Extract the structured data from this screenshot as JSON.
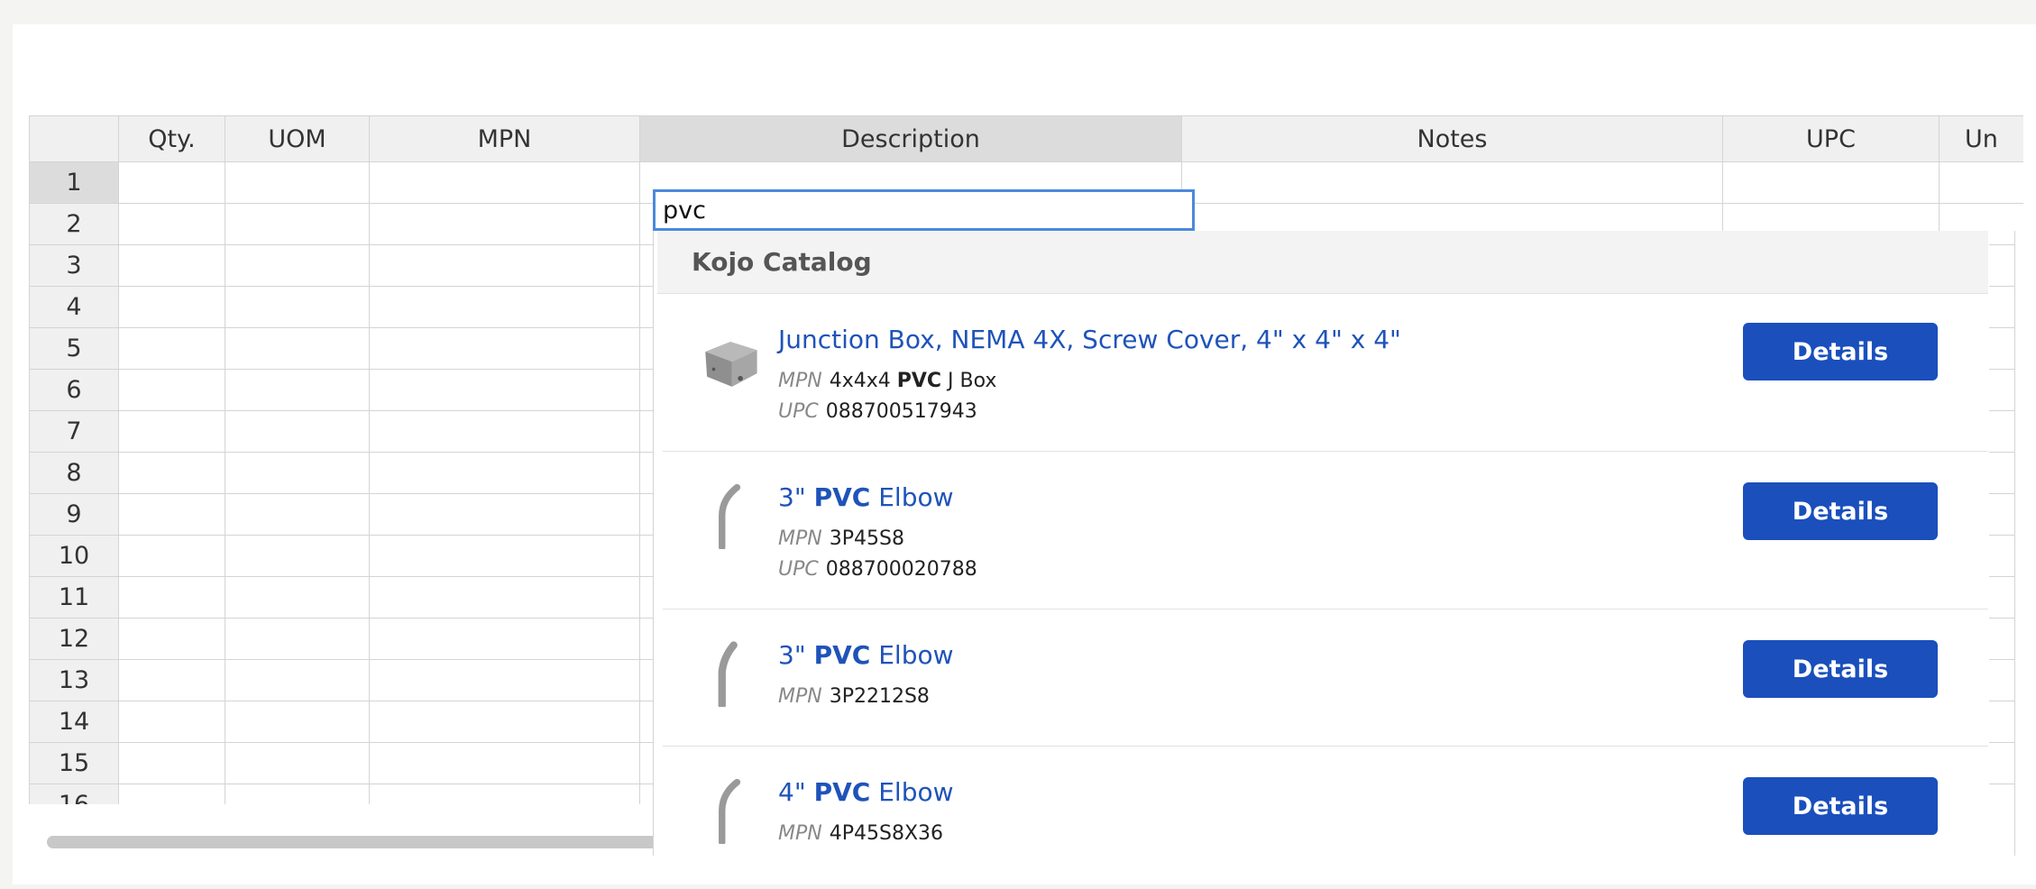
{
  "grid": {
    "headers": [
      "",
      "Qty.",
      "UOM",
      "MPN",
      "Description",
      "Notes",
      "UPC",
      "Un"
    ],
    "rows": [
      "1",
      "2",
      "3",
      "4",
      "5",
      "6",
      "7",
      "8",
      "9",
      "10",
      "11",
      "12",
      "13",
      "14",
      "15",
      "16"
    ],
    "active_row": "1",
    "active_column": "Description",
    "editor_value": "pvc"
  },
  "dropdown": {
    "section_title": "Kojo Catalog",
    "mpn_label": "MPN",
    "upc_label": "UPC",
    "details_label": "Details",
    "items": [
      {
        "title_before": "Junction Box, NEMA 4X, Screw Cover, 4\" x 4\" x 4\"",
        "title_bold": "",
        "title_after": "",
        "mpn_before": "4x4x4 ",
        "mpn_bold": "PVC",
        "mpn_after": " J Box",
        "upc": "088700517943",
        "icon": "junction-box-icon"
      },
      {
        "title_before": "3\" ",
        "title_bold": "PVC",
        "title_after": " Elbow",
        "mpn_before": "3P45S8",
        "mpn_bold": "",
        "mpn_after": "",
        "upc": "088700020788",
        "icon": "elbow-pipe-icon"
      },
      {
        "title_before": "3\" ",
        "title_bold": "PVC",
        "title_after": " Elbow",
        "mpn_before": "3P2212S8",
        "mpn_bold": "",
        "mpn_after": "",
        "upc": "",
        "icon": "elbow-pipe-icon"
      },
      {
        "title_before": "4\" ",
        "title_bold": "PVC",
        "title_after": " Elbow",
        "mpn_before": "4P45S8X36",
        "mpn_bold": "",
        "mpn_after": "",
        "upc": "",
        "icon": "elbow-pipe-icon"
      }
    ]
  },
  "colors": {
    "link_blue": "#1f53b9",
    "button_blue": "#1a4fbc",
    "editor_border": "#4a89dc",
    "header_bg": "#f0f0f0"
  }
}
